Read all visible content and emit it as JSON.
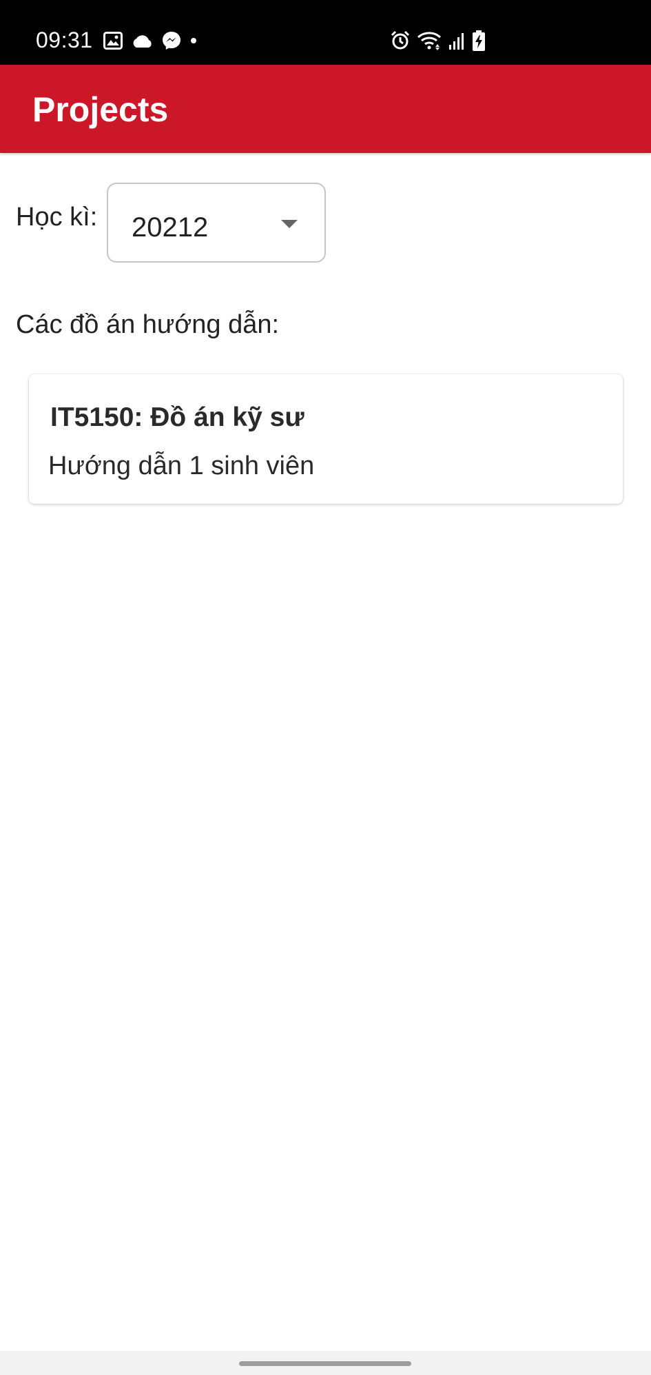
{
  "status_bar": {
    "time": "09:31",
    "left_icons": [
      "image-icon",
      "cloud-icon",
      "messenger-icon",
      "dot-icon"
    ],
    "right_icons": [
      "alarm-icon",
      "wifi-icon",
      "signal-icon",
      "battery-charging-icon"
    ]
  },
  "app_bar": {
    "title": "Projects",
    "color": "#cc1729"
  },
  "semester": {
    "label": "Học kì:",
    "selected_value": "20212"
  },
  "projects_section": {
    "heading": "Các đồ án hướng dẫn:",
    "items": [
      {
        "title": "IT5150: Đồ án kỹ sư",
        "subtitle": "Hướng dẫn 1 sinh viên"
      }
    ]
  }
}
